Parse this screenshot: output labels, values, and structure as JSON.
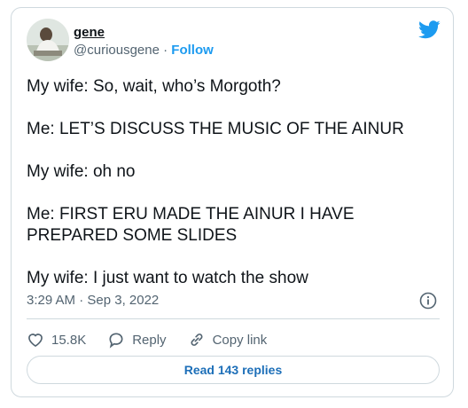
{
  "author": {
    "name": "gene",
    "handle": "@curiousgene",
    "separator": "·",
    "follow_label": "Follow"
  },
  "tweet": {
    "lines": [
      "My wife: So, wait, who’s Morgoth?",
      "Me: LET’S DISCUSS THE MUSIC OF THE AINUR",
      "My wife: oh no",
      "Me: FIRST ERU MADE THE AINUR I HAVE PREPARED SOME SLIDES",
      "My wife: I just want to watch the show"
    ],
    "timestamp": "3:29 AM · Sep 3, 2022"
  },
  "actions": {
    "likes": "15.8K",
    "reply_label": "Reply",
    "copy_link_label": "Copy link"
  },
  "replies_button": "Read 143 replies",
  "colors": {
    "brand_blue": "#1d9bf0",
    "text_secondary": "#536471",
    "border": "#cfd9de"
  },
  "icons": [
    "twitter-bird-icon",
    "info-icon",
    "heart-icon",
    "reply-icon",
    "link-icon"
  ]
}
